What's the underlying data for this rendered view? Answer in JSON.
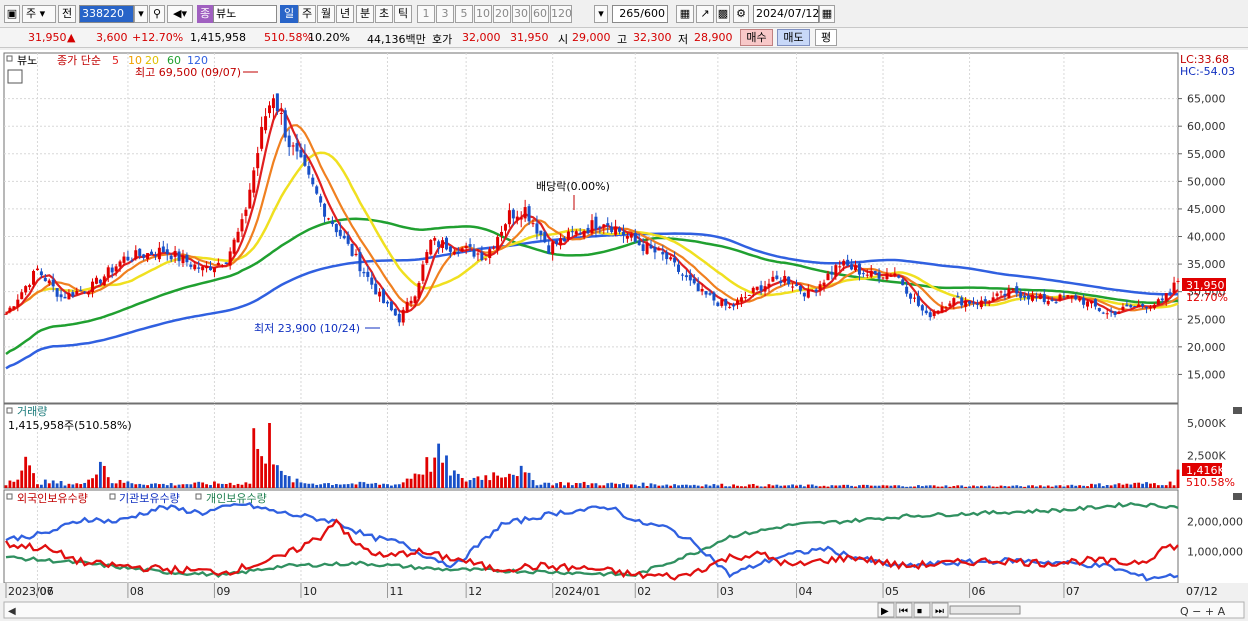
{
  "toolbar": {
    "market": "주",
    "period_prefix": "전",
    "code": "338220",
    "type_badge": "종",
    "name": "뷰노",
    "periods": [
      "일",
      "주",
      "월",
      "년",
      "분",
      "초",
      "틱"
    ],
    "intervals": [
      "1",
      "3",
      "5",
      "10",
      "20",
      "30",
      "60",
      "120"
    ],
    "count": "265",
    "count_max": "/600",
    "date": "2024/07/12"
  },
  "quote": {
    "price": "31,950",
    "change": "3,600",
    "change_pct": "+12.70%",
    "volume": "1,415,958",
    "vol_ratio": "510.58%",
    "turnover": "10.20%",
    "amount": "44,136백만",
    "bid_label": "호가",
    "bid1": "32,000",
    "bid2": "31,950",
    "open_label": "시",
    "open": "29,000",
    "high_label": "고",
    "high": "32,300",
    "low_label": "저",
    "low": "28,900",
    "buy_label": "매수",
    "sell_label": "매도",
    "eval_label": "평"
  },
  "legend": {
    "name": "뷰노",
    "ma_label": "종가 단순",
    "ma_periods": [
      "5",
      "10",
      "20",
      "60",
      "120"
    ],
    "lc": "LC:33.68",
    "hc": "HC:-54.03",
    "max_note": "최고 69,500 (09/07)",
    "min_note": "최저 23,900 (10/24)",
    "div_note": "배당락(0.00%)",
    "price_tag": "31,950",
    "pct_tag": "12.70%"
  },
  "volume": {
    "title": "거래량",
    "info": "1,415,958주(510.58%)",
    "tag": "1,416K",
    "tag_pct": "510.58%"
  },
  "holdings": {
    "foreign": "외국인보유수량",
    "inst": "기관보유수량",
    "indiv": "개인보유수량"
  },
  "chart_data": {
    "type": "candlestick",
    "x_labels": [
      "2023/06",
      "07",
      "08",
      "09",
      "10",
      "11",
      "12",
      "2024/01",
      "02",
      "03",
      "04",
      "05",
      "06",
      "07",
      "07/12"
    ],
    "price_axis": [
      "65,000",
      "60,000",
      "55,000",
      "50,000",
      "45,000",
      "40,000",
      "35,000",
      "30,000",
      "25,000",
      "20,000",
      "15,000"
    ],
    "price_range": [
      10000,
      72000
    ],
    "volume_axis": [
      "5,000K",
      "2,500K"
    ],
    "holdings_axis": [
      "2,000,000",
      "1,000,000"
    ],
    "close_keys": [
      [
        0,
        26000
      ],
      [
        8,
        34000
      ],
      [
        14,
        29000
      ],
      [
        22,
        31000
      ],
      [
        30,
        36000
      ],
      [
        40,
        37500
      ],
      [
        50,
        34000
      ],
      [
        56,
        36000
      ],
      [
        60,
        42000
      ],
      [
        63,
        52000
      ],
      [
        66,
        62000
      ],
      [
        68,
        66000
      ],
      [
        72,
        57000
      ],
      [
        80,
        46000
      ],
      [
        88,
        37000
      ],
      [
        96,
        28000
      ],
      [
        100,
        25000
      ],
      [
        104,
        30000
      ],
      [
        108,
        39000
      ],
      [
        115,
        38000
      ],
      [
        122,
        36500
      ],
      [
        128,
        44000
      ],
      [
        132,
        45000
      ],
      [
        138,
        38000
      ],
      [
        146,
        41000
      ],
      [
        152,
        43000
      ],
      [
        160,
        39000
      ],
      [
        168,
        36000
      ],
      [
        176,
        30000
      ],
      [
        184,
        27000
      ],
      [
        192,
        31000
      ],
      [
        198,
        32500
      ],
      [
        204,
        29500
      ],
      [
        212,
        35000
      ],
      [
        220,
        33000
      ],
      [
        226,
        33500
      ],
      [
        234,
        25500
      ],
      [
        240,
        28500
      ],
      [
        248,
        28000
      ],
      [
        256,
        30000
      ],
      [
        264,
        28500
      ],
      [
        272,
        29000
      ],
      [
        280,
        26000
      ],
      [
        288,
        27500
      ],
      [
        294,
        28000
      ],
      [
        298,
        31950
      ]
    ],
    "volume_keys": [
      [
        0,
        0.35
      ],
      [
        5,
        1.8
      ],
      [
        8,
        0.5
      ],
      [
        20,
        0.3
      ],
      [
        24,
        2.4
      ],
      [
        27,
        0.5
      ],
      [
        40,
        0.3
      ],
      [
        62,
        0.4
      ],
      [
        63,
        4.0
      ],
      [
        65,
        2.0
      ],
      [
        67,
        4.0
      ],
      [
        70,
        1.0
      ],
      [
        75,
        0.4
      ],
      [
        100,
        0.3
      ],
      [
        110,
        2.5
      ],
      [
        112,
        1.8
      ],
      [
        116,
        0.6
      ],
      [
        130,
        1.5
      ],
      [
        135,
        0.4
      ],
      [
        160,
        0.3
      ],
      [
        200,
        0.2
      ],
      [
        260,
        0.15
      ],
      [
        297,
        0.4
      ],
      [
        298,
        1.416
      ]
    ],
    "foreign_keys": [
      [
        0,
        1.25
      ],
      [
        10,
        1.1
      ],
      [
        20,
        0.6
      ],
      [
        40,
        0.4
      ],
      [
        56,
        0.3
      ],
      [
        70,
        0.8
      ],
      [
        80,
        1.5
      ],
      [
        84,
        2.1
      ],
      [
        88,
        1.3
      ],
      [
        96,
        0.8
      ],
      [
        104,
        1.0
      ],
      [
        116,
        0.7
      ],
      [
        124,
        0.4
      ],
      [
        136,
        0.5
      ],
      [
        150,
        0.4
      ],
      [
        160,
        0.2
      ],
      [
        172,
        0.15
      ],
      [
        184,
        0.8
      ],
      [
        192,
        0.9
      ],
      [
        200,
        0.5
      ],
      [
        208,
        0.7
      ],
      [
        216,
        0.8
      ],
      [
        228,
        0.5
      ],
      [
        240,
        0.6
      ],
      [
        252,
        0.7
      ],
      [
        264,
        0.6
      ],
      [
        276,
        0.7
      ],
      [
        284,
        0.6
      ],
      [
        290,
        0.7
      ],
      [
        294,
        1.1
      ],
      [
        298,
        1.2
      ]
    ],
    "inst_keys": [
      [
        0,
        1.4
      ],
      [
        10,
        1.6
      ],
      [
        20,
        2.1
      ],
      [
        28,
        2.0
      ],
      [
        40,
        2.5
      ],
      [
        50,
        2.3
      ],
      [
        60,
        2.6
      ],
      [
        70,
        2.3
      ],
      [
        84,
        2.0
      ],
      [
        92,
        1.5
      ],
      [
        100,
        1.3
      ],
      [
        106,
        0.9
      ],
      [
        114,
        0.5
      ],
      [
        126,
        1.9
      ],
      [
        140,
        2.3
      ],
      [
        154,
        2.5
      ],
      [
        160,
        2.0
      ],
      [
        168,
        1.8
      ],
      [
        176,
        1.2
      ],
      [
        184,
        0.2
      ],
      [
        196,
        0.8
      ],
      [
        208,
        1.1
      ],
      [
        216,
        0.8
      ],
      [
        226,
        0.5
      ],
      [
        240,
        0.6
      ],
      [
        256,
        0.7
      ],
      [
        270,
        0.6
      ],
      [
        280,
        0.5
      ],
      [
        290,
        0.1
      ],
      [
        298,
        0.2
      ]
    ],
    "indiv_keys": [
      [
        0,
        0.8
      ],
      [
        20,
        0.6
      ],
      [
        40,
        0.3
      ],
      [
        56,
        0.2
      ],
      [
        70,
        0.5
      ],
      [
        90,
        0.6
      ],
      [
        110,
        0.4
      ],
      [
        140,
        0.3
      ],
      [
        160,
        0.2
      ],
      [
        176,
        1.0
      ],
      [
        184,
        1.5
      ],
      [
        200,
        1.9
      ],
      [
        212,
        2.0
      ],
      [
        230,
        2.2
      ],
      [
        250,
        2.3
      ],
      [
        270,
        2.4
      ],
      [
        286,
        2.6
      ],
      [
        298,
        2.5
      ]
    ]
  },
  "colors": {
    "up": "#e00000",
    "down": "#1850c8",
    "ma5": "#e02020",
    "ma10": "#f08020",
    "ma20": "#f0e020",
    "ma60": "#20a030",
    "ma120": "#3060e0",
    "foreign": "#e01010",
    "inst": "#3060e0",
    "indiv": "#309060"
  }
}
